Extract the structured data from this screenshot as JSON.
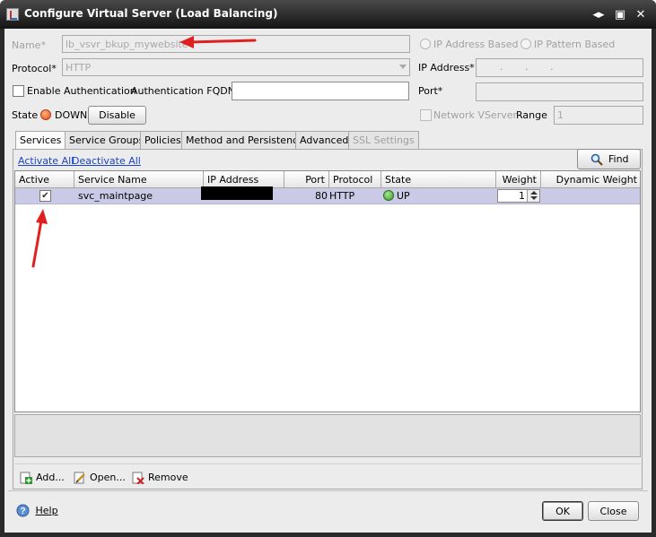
{
  "window": {
    "title": "Configure Virtual Server (Load Balancing)",
    "controls": {
      "restore": "◂▸",
      "maximize": "▣",
      "close": "✕"
    }
  },
  "form": {
    "name_label": "Name*",
    "name_value": "lb_vsvr_bkup_mywebsite",
    "protocol_label": "Protocol*",
    "protocol_value": "HTTP",
    "enable_auth_label": "Enable Authentication",
    "auth_fqdn_label": "Authentication FQDN",
    "auth_fqdn_value": "",
    "state_label": "State",
    "state_value": "DOWN",
    "disable_button": "Disable",
    "ip_address_based": "IP Address Based",
    "ip_pattern_based": "IP Pattern Based",
    "ip_address_label": "IP Address*",
    "ip_address_value": ".       .       .",
    "port_label": "Port*",
    "port_value": "",
    "network_vserver_label": "Network VServer",
    "range_label": "Range",
    "range_value": "1"
  },
  "tabs": [
    {
      "label": "Services"
    },
    {
      "label": "Service Groups"
    },
    {
      "label": "Policies"
    },
    {
      "label": "Method and Persistence"
    },
    {
      "label": "Advanced"
    },
    {
      "label": "SSL Settings"
    }
  ],
  "services": {
    "activate_all": "Activate All",
    "deactivate_all": "Deactivate All",
    "find_button": "Find",
    "columns": [
      "Active",
      "Service Name",
      "IP Address",
      "Port",
      "Protocol",
      "State",
      "Weight",
      "Dynamic Weight"
    ],
    "rows": [
      {
        "active": "✔",
        "service_name": "svc_maintpage",
        "ip_address": "",
        "port": "80",
        "protocol": "HTTP",
        "state": "UP",
        "weight": "1",
        "dynamic_weight": ""
      }
    ]
  },
  "toolbar": {
    "add": "Add...",
    "open": "Open...",
    "remove": "Remove"
  },
  "footer": {
    "help": "Help",
    "ok": "OK",
    "close": "Close"
  },
  "colors": {
    "selection_row": "#cacae6",
    "annotation_arrow": "#e02020",
    "link": "#1a44c8"
  }
}
